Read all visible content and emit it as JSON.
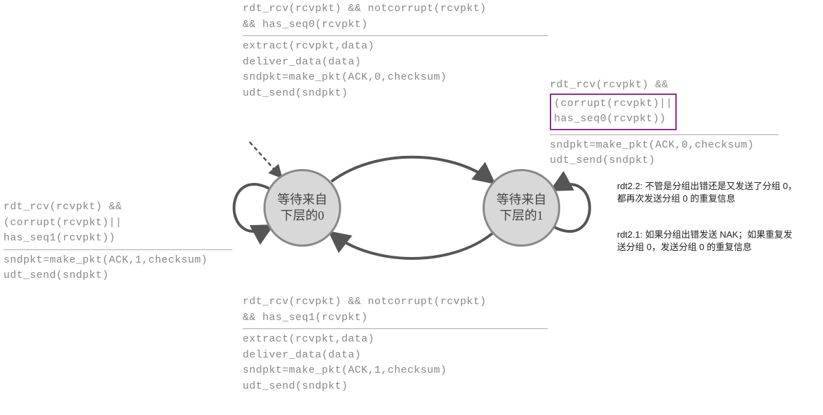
{
  "states": {
    "s0": "等待来自\n下层的0",
    "s1": "等待来自\n下层的1"
  },
  "top": {
    "cond1": "rdt_rcv(rcvpkt) && notcorrupt(rcvpkt)",
    "cond2": "&& has_seq0(rcvpkt)",
    "act1": "extract(rcvpkt,data)",
    "act2": "deliver_data(data)",
    "act3": "sndpkt=make_pkt(ACK,0,checksum)",
    "act4": "udt_send(sndpkt)"
  },
  "bottom": {
    "cond1": "rdt_rcv(rcvpkt) && notcorrupt(rcvpkt)",
    "cond2": "&& has_seq1(rcvpkt)",
    "act1": "extract(rcvpkt,data)",
    "act2": "deliver_data(data)",
    "act3": "sndpkt=make_pkt(ACK,1,checksum)",
    "act4": "udt_send(sndpkt)"
  },
  "left": {
    "cond1": "rdt_rcv(rcvpkt) &&",
    "cond2": "(corrupt(rcvpkt)||",
    "cond3": "has_seq1(rcvpkt))",
    "act1": "sndpkt=make_pkt(ACK,1,checksum)",
    "act2": "udt_send(sndpkt)"
  },
  "right": {
    "cond1": "rdt_rcv(rcvpkt) &&",
    "cond2": "(corrupt(rcvpkt)||",
    "cond3": "has_seq0(rcvpkt))",
    "act1": "sndpkt=make_pkt(ACK,0,checksum)",
    "act2": "udt_send(sndpkt)"
  },
  "notes": {
    "n1": "rdt2.2: 不管是分组出错还是又发送了分组 0，都再次发送分组 0 的重复信息",
    "n2": "rdt2.1: 如果分组出错发送 NAK；如果重复发送分组 0，发送分组 0 的重复信息"
  }
}
